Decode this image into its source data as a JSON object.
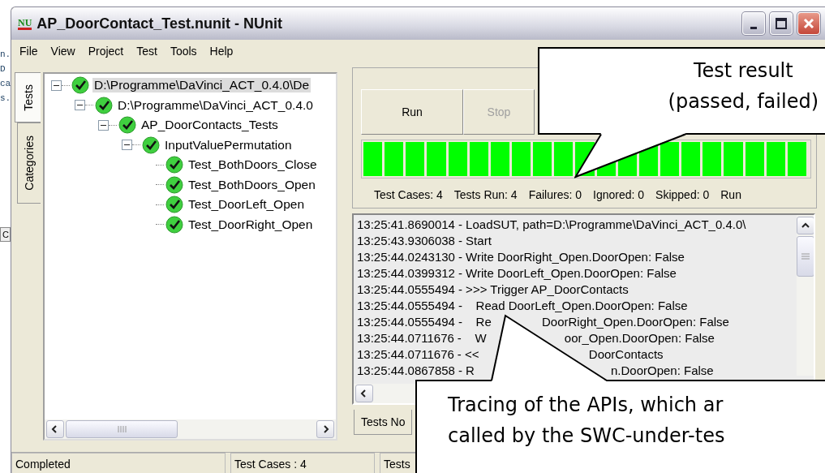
{
  "background_fragments": [
    {
      "kind": "text",
      "text": "n."
    },
    {
      "kind": "text",
      "text": "D"
    },
    {
      "kind": "text",
      "text": "ca"
    },
    {
      "kind": "text",
      "text": "s."
    },
    {
      "kind": "button",
      "text": "C"
    }
  ],
  "window": {
    "logo": "NU",
    "title": "AP_DoorContact_Test.nunit - NUnit"
  },
  "menu": [
    "File",
    "View",
    "Project",
    "Test",
    "Tools",
    "Help"
  ],
  "side_tabs": [
    {
      "label": "Tests",
      "selected": true
    },
    {
      "label": "Categories",
      "selected": false
    }
  ],
  "tree": [
    {
      "label": "D:\\Programme\\DaVinci_ACT_0.4.0\\De",
      "passed": true,
      "expanded": true,
      "selected": true,
      "children": [
        {
          "label": "D:\\Programme\\DaVinci_ACT_0.4.0",
          "passed": true,
          "expanded": true,
          "selected": false,
          "children": [
            {
              "label": "AP_DoorContacts_Tests",
              "passed": true,
              "expanded": true,
              "selected": false,
              "children": [
                {
                  "label": "InputValuePermutation",
                  "passed": true,
                  "expanded": true,
                  "selected": false,
                  "children": [
                    {
                      "label": "Test_BothDoors_Close",
                      "passed": true,
                      "selected": false
                    },
                    {
                      "label": "Test_BothDoors_Open",
                      "passed": true,
                      "selected": false
                    },
                    {
                      "label": "Test_DoorLeft_Open",
                      "passed": true,
                      "selected": false
                    },
                    {
                      "label": "Test_DoorRight_Open",
                      "passed": true,
                      "selected": false
                    }
                  ]
                }
              ]
            }
          ]
        }
      ]
    }
  ],
  "run_buttons": [
    {
      "label": "Run",
      "disabled": false
    },
    {
      "label": "Stop",
      "disabled": true
    }
  ],
  "progress": {
    "level": 1
  },
  "summary": [
    "Test Cases: 4",
    "Tests Run: 4",
    "Failures: 0",
    "Ignored: 0",
    "Skipped: 0",
    "Run"
  ],
  "log": [
    {
      "time": "13:25:41.8690014",
      "parts": [
        "- LoadSUT, path=D:\\Programme\\DaVinci_ACT_0.4.0\\"
      ]
    },
    {
      "time": "13:25:43.9306038",
      "parts": [
        "- Start"
      ]
    },
    {
      "time": "13:25:44.0243130",
      "parts": [
        "- Write DoorRight_Open.DoorOpen: False"
      ]
    },
    {
      "time": "13:25:44.0399312",
      "parts": [
        "- Write DoorLeft_Open.DoorOpen: False"
      ]
    },
    {
      "time": "13:25:44.0555494",
      "parts": [
        "- >>> Trigger AP_DoorContacts"
      ]
    },
    {
      "time": "13:25:44.0555494",
      "parts": [
        "-    Read DoorLeft_Open.DoorOpen: False"
      ]
    },
    {
      "time": "13:25:44.0555494",
      "parts": [
        "-    Re",
        "DoorRight_Open.DoorOpen: False"
      ]
    },
    {
      "time": "13:25:44.0711676",
      "parts": [
        "-    W",
        "oor_Open.DoorOpen: False"
      ]
    },
    {
      "time": "13:25:44.0711676",
      "parts": [
        "- <<",
        "DoorContacts"
      ]
    },
    {
      "time": "13:25:44.0867858",
      "parts": [
        "- R",
        "n.DoorOpen: False"
      ]
    }
  ],
  "bottom_tabs": [
    "Tests No"
  ],
  "status_bar": [
    "Completed",
    "Test Cases : 4",
    "Tests"
  ],
  "callouts": [
    {
      "lines": [
        "Test result",
        "(passed, failed)"
      ]
    },
    {
      "lines": [
        "Tracing of the APIs, which ar",
        "called by the SWC-under-tes"
      ]
    }
  ]
}
